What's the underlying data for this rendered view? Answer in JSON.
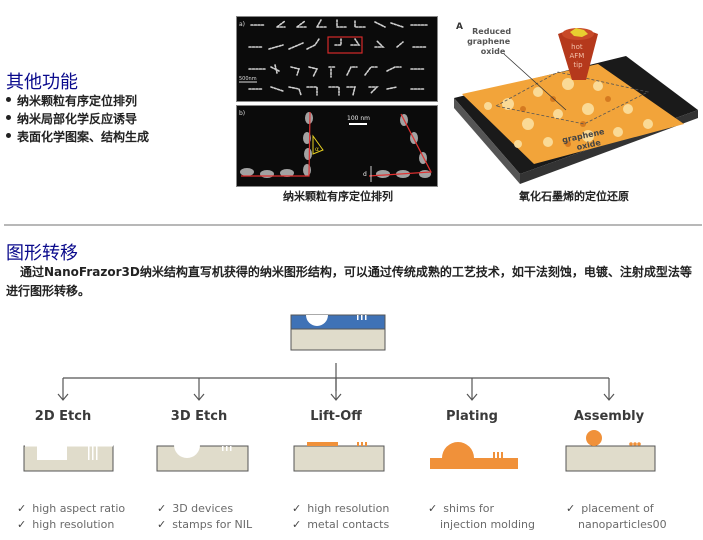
{
  "other_functions": {
    "title": "其他功能",
    "bullets": [
      "纳米颗粒有序定位排列",
      "纳米局部化学反应诱导",
      "表面化学图案、结构生成"
    ]
  },
  "figure_nanoparticles": {
    "panel_a_label": "a)",
    "panel_b_label": "b)",
    "scale_a": "500nm",
    "scale_b": "100 nm",
    "angle_label": "α",
    "distance_label": "d",
    "caption": "纳米颗粒有序定位排列"
  },
  "figure_graphene": {
    "panel_label": "A",
    "label_reduced": [
      "Reduced",
      "graphene",
      "oxide"
    ],
    "label_tip": [
      "hot",
      "AFM",
      "tip"
    ],
    "label_go": [
      "graphene",
      "oxide"
    ],
    "caption": "氧化石墨烯的定位还原"
  },
  "pattern_transfer": {
    "title": "图形转移",
    "paragraph": "通过NanoFrazor3D纳米结构直写机获得的纳米图形结构，可以通过传统成熟的工艺技术，如干法刻蚀，电镀、注射成型法等进行图形转移。",
    "processes": [
      {
        "name": "2D Etch",
        "notes": [
          "high aspect ratio",
          "high resolution"
        ],
        "checks": [
          true,
          true
        ]
      },
      {
        "name": "3D Etch",
        "notes": [
          "3D devices",
          "stamps for NIL"
        ],
        "checks": [
          true,
          true
        ]
      },
      {
        "name": "Lift-Off",
        "notes": [
          "high resolution",
          "metal contacts"
        ],
        "checks": [
          true,
          true
        ]
      },
      {
        "name": "Plating",
        "notes": [
          "shims for",
          "injection molding"
        ],
        "checks": [
          true,
          false
        ]
      },
      {
        "name": "Assembly",
        "notes": [
          "placement of",
          "nanoparticles00"
        ],
        "checks": [
          true,
          false
        ]
      }
    ],
    "check_glyph": "✓"
  },
  "colors": {
    "title_blue": "#0a0a8c",
    "resist_blue": "#3f72b6",
    "substrate_beige": "#e0dccb",
    "metal_orange": "#f0913a"
  }
}
